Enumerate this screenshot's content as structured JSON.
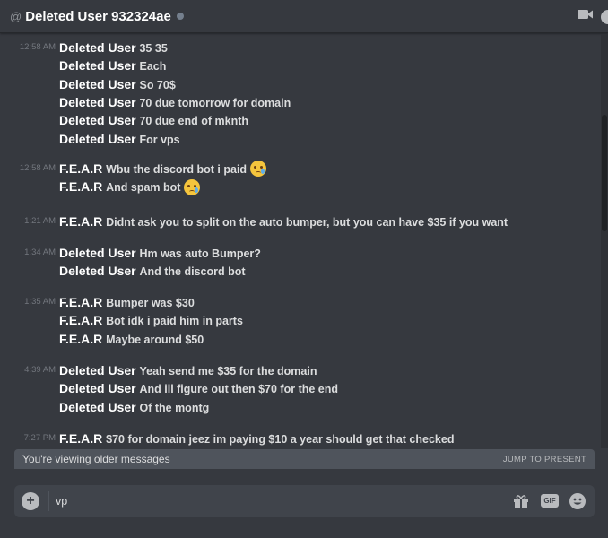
{
  "header": {
    "at_symbol": "@",
    "channel_name": "Deleted User 932324ae"
  },
  "groups": [
    {
      "timestamp": "12:58 AM",
      "lines": [
        {
          "author": "Deleted User",
          "text": "35 35"
        },
        {
          "author": "Deleted User",
          "text": "Each"
        },
        {
          "author": "Deleted User",
          "text": "So 70$"
        },
        {
          "author": "Deleted User",
          "text": "70 due tomorrow for domain"
        },
        {
          "author": "Deleted User",
          "text": "70 due end of mknth"
        },
        {
          "author": "Deleted User",
          "text": "For vps"
        }
      ]
    },
    {
      "timestamp": "12:58 AM",
      "lines": [
        {
          "author": "F.E.A.R",
          "text": "Wbu the discord bot i paid",
          "emoji": "crying-face"
        },
        {
          "author": "F.E.A.R",
          "text": "And spam bot",
          "emoji": "crying-face"
        }
      ]
    },
    {
      "timestamp": "1:21 AM",
      "lines": [
        {
          "author": "F.E.A.R",
          "text": "Didnt ask you to split on the auto bumper, but you can have $35 if you want"
        }
      ]
    },
    {
      "timestamp": "1:34 AM",
      "lines": [
        {
          "author": "Deleted User",
          "text": "Hm was auto Bumper?"
        },
        {
          "author": "Deleted User",
          "text": "And the discord bot"
        }
      ]
    },
    {
      "timestamp": "1:35 AM",
      "lines": [
        {
          "author": "F.E.A.R",
          "text": "Bumper was $30"
        },
        {
          "author": "F.E.A.R",
          "text": "Bot idk i paid him in parts"
        },
        {
          "author": "F.E.A.R",
          "text": "Maybe around $50"
        }
      ]
    },
    {
      "timestamp": "4:39 AM",
      "lines": [
        {
          "author": "Deleted User",
          "text": "Yeah send me $35 for the domain"
        },
        {
          "author": "Deleted User",
          "text": "And ill figure out then $70 for the end"
        },
        {
          "author": "Deleted User",
          "text": "Of the montg"
        }
      ]
    },
    {
      "timestamp": "7:27 PM",
      "lines": [
        {
          "author": "F.E.A.R",
          "text": "$70 for domain jeez im paying $10 a year should get that checked"
        }
      ]
    }
  ],
  "older_bar": {
    "text": "You're viewing older messages",
    "jump_label": "JUMP TO PRESENT"
  },
  "composer": {
    "value": "vp",
    "gif_label": "GIF"
  }
}
